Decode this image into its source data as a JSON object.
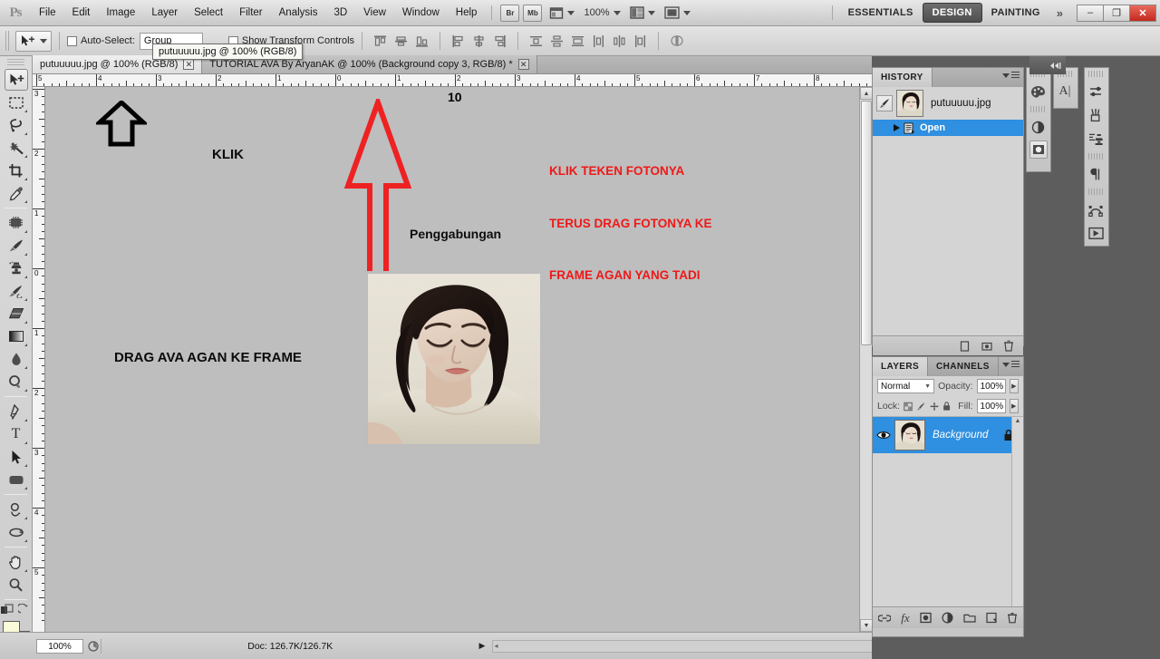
{
  "app": {
    "logo": "Ps",
    "title": "Adobe Photoshop"
  },
  "menubar": {
    "items": [
      "File",
      "Edit",
      "Image",
      "Layer",
      "Select",
      "Filter",
      "Analysis",
      "3D",
      "View",
      "Window",
      "Help"
    ],
    "bridge_label": "Br",
    "minibridge_label": "Mb",
    "view_extras_icon": "screen-mode-icon",
    "zoom_value": "100%",
    "arrange_icon": "arrange-documents-icon",
    "screen_icon": "screen-mode-icon",
    "workspaces": [
      {
        "label": "ESSENTIALS",
        "active": false
      },
      {
        "label": "DESIGN",
        "active": true
      },
      {
        "label": "PAINTING",
        "active": false
      }
    ],
    "more_workspaces": "»",
    "window_buttons": {
      "minimize": "–",
      "restore": "❐",
      "close": "✕"
    }
  },
  "options_bar": {
    "tool_icon": "move-tool-icon",
    "auto_select_label": "Auto-Select:",
    "auto_select_checked": false,
    "group_value": "Group",
    "show_transform_label": "Show Transform Controls",
    "show_transform_checked": false,
    "align_icons": [
      "align-top-edges-icon",
      "align-vertical-centers-icon",
      "align-bottom-edges-icon",
      "align-left-edges-icon",
      "align-horizontal-centers-icon",
      "align-right-edges-icon",
      "distribute-top-edges-icon",
      "distribute-vertical-centers-icon",
      "distribute-bottom-edges-icon",
      "distribute-left-edges-icon",
      "distribute-horizontal-centers-icon",
      "distribute-right-edges-icon",
      "auto-align-layers-icon"
    ]
  },
  "tooltip": {
    "text": "putuuuuu.jpg @ 100% (RGB/8)"
  },
  "document_tabs": [
    {
      "label": "putuuuuu.jpg @ 100% (RGB/8)",
      "active": true,
      "close": "✕"
    },
    {
      "label": "TUTORIAL AVA By AryanAK @ 100%  (Background copy 3, RGB/8) *",
      "active": false,
      "close": "✕"
    }
  ],
  "toolbox": {
    "tools": [
      {
        "name": "move-tool",
        "glyph": "✙",
        "active": true,
        "has_flyout": false
      },
      {
        "name": "rectangular-marquee-tool",
        "glyph": "⬚",
        "active": false,
        "has_flyout": true
      },
      {
        "name": "lasso-tool",
        "glyph": "➿",
        "active": false,
        "has_flyout": true
      },
      {
        "name": "magic-wand-tool",
        "glyph": "✸",
        "active": false,
        "has_flyout": true
      },
      {
        "name": "crop-tool",
        "glyph": "⎄",
        "active": false,
        "has_flyout": true
      },
      {
        "name": "eyedropper-tool",
        "glyph": "✒",
        "active": false,
        "has_flyout": true
      },
      {
        "name": "spot-healing-brush-tool",
        "glyph": "▦",
        "active": false,
        "has_flyout": true
      },
      {
        "name": "brush-tool",
        "glyph": "✐",
        "active": false,
        "has_flyout": true
      },
      {
        "name": "clone-stamp-tool",
        "glyph": "⁂",
        "active": false,
        "has_flyout": true
      },
      {
        "name": "history-brush-tool",
        "glyph": "✎",
        "active": false,
        "has_flyout": true
      },
      {
        "name": "eraser-tool",
        "glyph": "▰",
        "active": false,
        "has_flyout": true
      },
      {
        "name": "gradient-tool",
        "glyph": "▤",
        "active": false,
        "has_flyout": true
      },
      {
        "name": "blur-tool",
        "glyph": "●",
        "active": false,
        "has_flyout": true
      },
      {
        "name": "dodge-tool",
        "glyph": "◔",
        "active": false,
        "has_flyout": true
      },
      {
        "name": "pen-tool",
        "glyph": "✑",
        "active": false,
        "has_flyout": true
      },
      {
        "name": "horizontal-type-tool",
        "glyph": "T",
        "active": false,
        "has_flyout": true
      },
      {
        "name": "path-selection-tool",
        "glyph": "➤",
        "active": false,
        "has_flyout": true
      },
      {
        "name": "rounded-rectangle-tool",
        "glyph": "▬",
        "active": false,
        "has_flyout": true
      },
      {
        "name": "3d-rotate-tool",
        "glyph": "◑",
        "active": false,
        "has_flyout": true
      },
      {
        "name": "3d-orbit-tool",
        "glyph": "↺",
        "active": false,
        "has_flyout": true
      },
      {
        "name": "hand-tool",
        "glyph": "✋",
        "active": false,
        "has_flyout": true
      },
      {
        "name": "zoom-tool",
        "glyph": "⚲",
        "active": false,
        "has_flyout": false
      }
    ],
    "quick_mask_icon": "quick-mask-icon",
    "foreground_color": "#fbfbd9",
    "background_color": "#000000"
  },
  "rulers": {
    "unit": "inches",
    "horizontal_labels": [
      "5",
      "4",
      "3",
      "2",
      "1",
      "0",
      "1",
      "2",
      "3",
      "4",
      "5",
      "6",
      "7",
      "8"
    ],
    "vertical_labels": [
      "3",
      "2",
      "1",
      "0",
      "1",
      "2",
      "3",
      "4",
      "5"
    ]
  },
  "canvas": {
    "background_color": "#bebebe",
    "annotations": [
      {
        "name": "klik-label",
        "text": "KLIK",
        "color": "#0b0b0b"
      },
      {
        "name": "ruler-ten-label",
        "text": "10",
        "color": "#000000"
      },
      {
        "name": "penggabungan-label",
        "text": "Penggabungan",
        "color": "#0d0d0d"
      },
      {
        "name": "drag-ava-label",
        "text": "DRAG AVA AGAN KE FRAME",
        "color": "#0b0b0b"
      }
    ],
    "red_instruction": {
      "color": "#f01818",
      "line1": "KLIK TEKEN FOTONYA",
      "line2": "TERUS DRAG FOTONYA KE",
      "line3": "FRAME AGAN YANG TADI"
    },
    "black_arrow_icon": "up-arrow-outline-icon",
    "red_arrow_icon": "red-up-arrow-icon",
    "photo_alt": "woman-portrait-photo"
  },
  "status_bar": {
    "zoom": "100%",
    "preview_icon": "preview-toggle-icon",
    "doc_info": "Doc: 126.7K/126.7K",
    "expand_icon": "▶"
  },
  "history_panel": {
    "tabs": [
      {
        "label": "HISTORY",
        "active": true
      }
    ],
    "snapshot": {
      "name": "putuuuuu.jpg",
      "brush_icon": "history-brush-source-icon"
    },
    "states": [
      {
        "label": "Open",
        "selected": true,
        "icon": "open-document-icon"
      }
    ],
    "bottom_icons": [
      "new-document-from-state-icon",
      "new-snapshot-icon",
      "delete-state-icon"
    ]
  },
  "layers_panel": {
    "tabs": [
      {
        "label": "LAYERS",
        "active": true
      },
      {
        "label": "CHANNELS",
        "active": false
      }
    ],
    "blend_mode": "Normal",
    "opacity_label": "Opacity:",
    "opacity_value": "100%",
    "lock_label": "Lock:",
    "lock_icons": [
      "lock-transparent-pixels-icon",
      "lock-image-pixels-icon",
      "lock-position-icon",
      "lock-all-icon"
    ],
    "fill_label": "Fill:",
    "fill_value": "100%",
    "layers": [
      {
        "name": "Background",
        "selected": true,
        "visible": true,
        "locked": true,
        "lock_icon": "lock-icon",
        "eye_icon": "eye-icon"
      }
    ],
    "bottom_icons": [
      "link-layers-icon",
      "layer-style-fx-icon",
      "add-layer-mask-icon",
      "new-adjustment-layer-icon",
      "new-group-icon",
      "new-layer-icon",
      "delete-layer-icon"
    ]
  },
  "icon_rails": {
    "left_rail": [
      "color-palette-icon",
      "adjustments-icon",
      "masks-icon"
    ],
    "middle_rail": [
      "character-icon"
    ],
    "right_rail": [
      "adjustments-panel-icon",
      "brushes-icon",
      "clone-source-icon",
      "paragraph-icon",
      "paths-icon",
      "animation-icon"
    ],
    "collapse_icon": "collapse-panels-icon"
  }
}
